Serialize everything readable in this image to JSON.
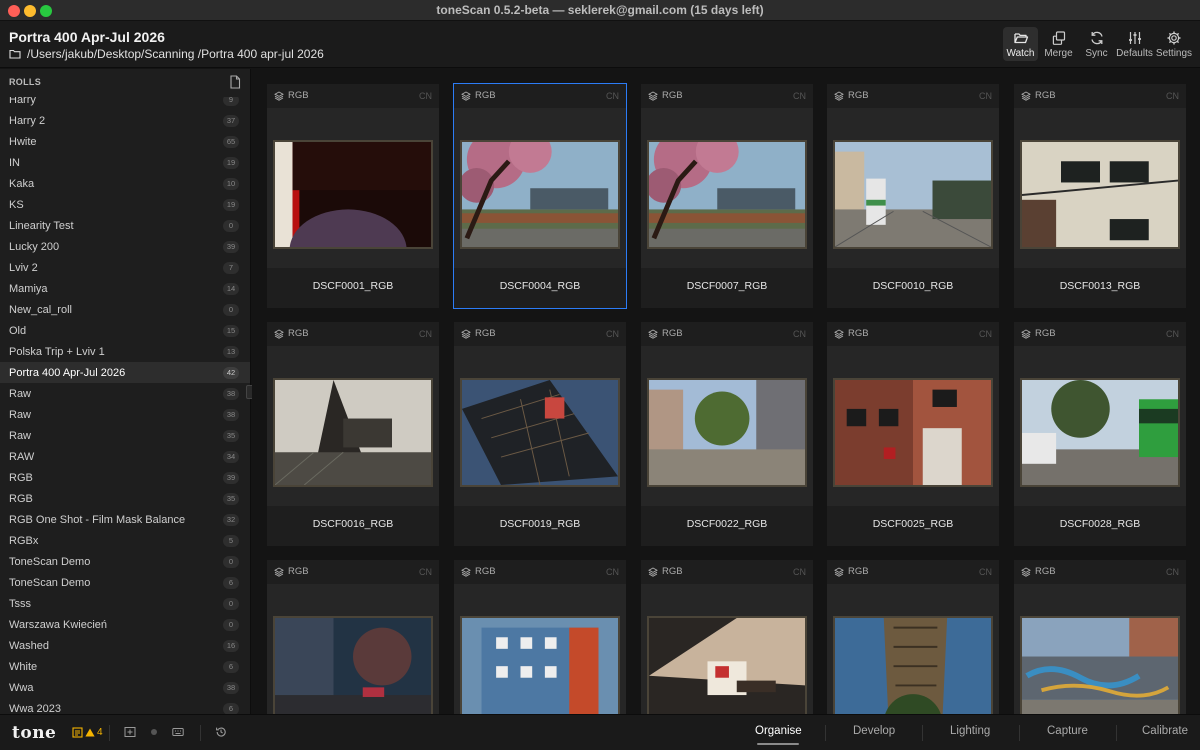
{
  "window": {
    "title": "toneScan 0.5.2-beta — seklerek@gmail.com (15 days left)"
  },
  "header": {
    "roll_title": "Portra 400 Apr-Jul 2026",
    "roll_path": "/Users/jakub/Desktop/Scanning /Portra 400 apr-jul 2026",
    "tools": [
      {
        "label": "Watch",
        "icon": "folder-open-icon",
        "active": true
      },
      {
        "label": "Merge",
        "icon": "copy-icon"
      },
      {
        "label": "Sync",
        "icon": "refresh-icon"
      },
      {
        "label": "Defaults",
        "icon": "sliders-icon"
      },
      {
        "label": "Settings",
        "icon": "gear-icon"
      }
    ]
  },
  "sidebar": {
    "heading": "ROLLS",
    "add_icon": "new-roll-icon",
    "items": [
      {
        "label": "Harry",
        "count": "9"
      },
      {
        "label": "Harry 2",
        "count": "37"
      },
      {
        "label": "Hwite",
        "count": "65"
      },
      {
        "label": "IN",
        "count": "19"
      },
      {
        "label": "Kaka",
        "count": "10"
      },
      {
        "label": "KS",
        "count": "19"
      },
      {
        "label": "Linearity Test",
        "count": "0"
      },
      {
        "label": "Lucky 200",
        "count": "39"
      },
      {
        "label": "Lviv 2",
        "count": "7"
      },
      {
        "label": "Mamiya",
        "count": "14"
      },
      {
        "label": "New_cal_roll",
        "count": "0"
      },
      {
        "label": "Old",
        "count": "15"
      },
      {
        "label": "Polska Trip + Lviv 1",
        "count": "13"
      },
      {
        "label": "Portra 400 Apr-Jul 2026",
        "count": "42",
        "selected": true
      },
      {
        "label": "Raw",
        "count": "38"
      },
      {
        "label": "Raw",
        "count": "38"
      },
      {
        "label": "Raw",
        "count": "35"
      },
      {
        "label": "RAW",
        "count": "34"
      },
      {
        "label": "RGB",
        "count": "39"
      },
      {
        "label": "RGB",
        "count": "35"
      },
      {
        "label": "RGB One Shot - Film Mask Balance",
        "count": "32"
      },
      {
        "label": "RGBx",
        "count": "5"
      },
      {
        "label": "ToneScan Demo",
        "count": "0"
      },
      {
        "label": "ToneScan Demo",
        "count": "6"
      },
      {
        "label": "Tsss",
        "count": "0"
      },
      {
        "label": "Warszawa Kwiecień",
        "count": "0"
      },
      {
        "label": "Washed",
        "count": "16"
      },
      {
        "label": "White",
        "count": "6"
      },
      {
        "label": "Wwa",
        "count": "38"
      },
      {
        "label": "Wwa 2023",
        "count": "6"
      }
    ]
  },
  "grid": {
    "badge": "RGB",
    "tag": "CN",
    "items": [
      {
        "name": "DSCF0001_RGB",
        "scene": "film-leader"
      },
      {
        "name": "DSCF0004_RGB",
        "scene": "blossom-tree",
        "selected": true
      },
      {
        "name": "DSCF0007_RGB",
        "scene": "blossom-tree"
      },
      {
        "name": "DSCF0010_RGB",
        "scene": "tram-street"
      },
      {
        "name": "DSCF0013_RGB",
        "scene": "white-building-rotated"
      },
      {
        "name": "DSCF0016_RGB",
        "scene": "white-wall-shadow"
      },
      {
        "name": "DSCF0019_RGB",
        "scene": "glass-facade"
      },
      {
        "name": "DSCF0022_RGB",
        "scene": "city-square"
      },
      {
        "name": "DSCF0025_RGB",
        "scene": "red-brick-corner"
      },
      {
        "name": "DSCF0028_RGB",
        "scene": "street-bus"
      },
      {
        "name": "",
        "scene": "night-street"
      },
      {
        "name": "",
        "scene": "blue-house-rotated"
      },
      {
        "name": "",
        "scene": "shadow-bench"
      },
      {
        "name": "",
        "scene": "tower"
      },
      {
        "name": "",
        "scene": "graffiti-wall"
      }
    ]
  },
  "footer": {
    "logo": "tone",
    "warning_count": "4",
    "nav": [
      {
        "label": "Organise",
        "active": true
      },
      {
        "label": "Develop"
      },
      {
        "label": "Lighting"
      },
      {
        "label": "Capture"
      },
      {
        "label": "Calibrate"
      }
    ]
  }
}
